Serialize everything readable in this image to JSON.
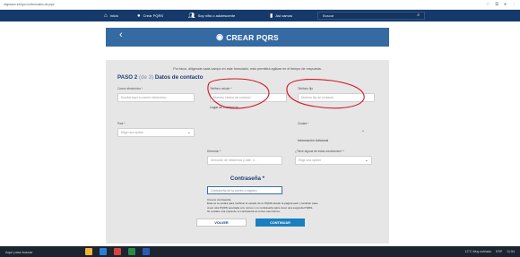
{
  "browser": {
    "url": "migracion.icbf.gov.co/formulario-de-pqrs",
    "icons": [
      "star-icon",
      "extension-icon",
      "profile-icon",
      "menu-icon"
    ]
  },
  "nav": {
    "items": [
      {
        "label": "Inicio",
        "icon": "home-icon"
      },
      {
        "label": "Crear PQRS",
        "icon": "chat-icon"
      },
      {
        "label": "Soy niño o adolescente",
        "icon": "people-icon"
      },
      {
        "label": "Así vamos",
        "icon": "chart-icon"
      }
    ],
    "search_placeholder": "Buscar"
  },
  "hero": {
    "back_icon": "back-arrow-icon",
    "title": "CREAR PQRS"
  },
  "form": {
    "intro": "Por favor, diligencie cada campo en este formulario, esto permitirá agilizar en el tiempo de respuesta.",
    "step_prefix": "PASO 2",
    "step_num": "(de 3)",
    "step_title": "Datos de contacto",
    "email_label": "Correo electrónico *",
    "email_placeholder": "Escribe aquí tu correo electrónico",
    "mobile_label": "Teléfono celular *",
    "mobile_placeholder": "Número celular de contacto",
    "phone_label": "Teléfono fijo",
    "phone_placeholder": "Número fijo de contacto",
    "place_label": "Lugar de residencia",
    "country_label": "País *",
    "country_value": "Elige una opción",
    "city_label": "Ciudad *",
    "additional_info": "Información Adicional",
    "address_label": "Dirección *",
    "address_placeholder": "Dirección de residencia (Calle, c...",
    "ethnic_label": "¿Tiene alguna de estas condiciones? *",
    "ethnic_value": "Elige una opción",
    "password_title": "Contraseña *",
    "password_placeholder": "Contraseña de tu correo o registro",
    "note_lines": [
      "Crea tu contraseña",
      "Esta se te pedirá para verificar el estado de tu PQRS desde la página web y también para",
      "crear otra PQRS asociada a tu correo o tu contraseña para crear una segunda PQRS.",
      "Te enviaré una copia de tu contraseña al correo electrónico."
    ],
    "back_label": "Volver",
    "continue_label": "Continuar"
  },
  "taskbar": {
    "search": "Aquí para buscar",
    "apps": [
      {
        "name": "file-explorer-icon",
        "color": "#f2b632"
      },
      {
        "name": "browser-icon",
        "color": "#2e7dd6"
      },
      {
        "name": "chrome-icon",
        "color": "#d8433b"
      },
      {
        "name": "mail-icon",
        "color": "#2a8a4a"
      },
      {
        "name": "word-icon",
        "color": "#2b5bb8"
      }
    ],
    "weather": "12°C Muy nublado",
    "lang": "ESP",
    "time": "11:54"
  },
  "colors": {
    "nav_bg": "#15396b",
    "hero_bg": "#356aa3",
    "card_bg": "#e6e6e6",
    "heading": "#1c3f74",
    "continue_bg": "#1a7fc0",
    "annotation": "#d0172a"
  }
}
